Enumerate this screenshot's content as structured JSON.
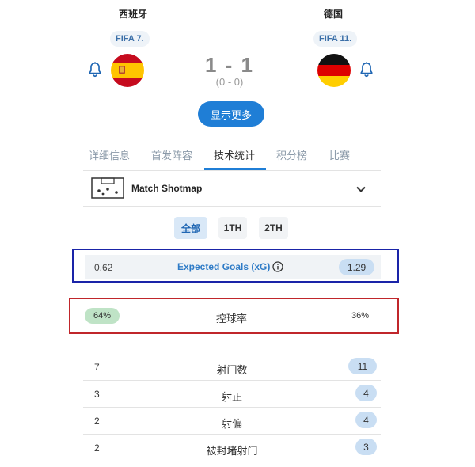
{
  "match": {
    "home": {
      "name": "西班牙",
      "fifa_rank": "FIFA 7.",
      "flag": "spain-flag"
    },
    "away": {
      "name": "德国",
      "fifa_rank": "FIFA 11.",
      "flag": "germany-flag"
    },
    "score": "1 - 1",
    "halftime": "(0 - 0)",
    "more_label": "显示更多"
  },
  "tabs": [
    {
      "label": "详细信息",
      "active": false
    },
    {
      "label": "首发阵容",
      "active": false
    },
    {
      "label": "技术统计",
      "active": true
    },
    {
      "label": "积分榜",
      "active": false
    },
    {
      "label": "比赛",
      "active": false
    }
  ],
  "shotmap": {
    "label": "Match Shotmap",
    "icon": "pitch-icon",
    "toggle_icon": "chevron-down-icon"
  },
  "periods": [
    {
      "label": "全部",
      "active": true
    },
    {
      "label": "1TH",
      "active": false
    },
    {
      "label": "2TH",
      "active": false
    }
  ],
  "stats": {
    "xg": {
      "label": "Expected Goals (xG)",
      "home": "0.62",
      "away": "1.29"
    },
    "possession": {
      "label": "控球率",
      "home": "64%",
      "away": "36%"
    },
    "rows": [
      {
        "label": "射门数",
        "home": "7",
        "away": "11"
      },
      {
        "label": "射正",
        "home": "3",
        "away": "4"
      },
      {
        "label": "射偏",
        "home": "2",
        "away": "4"
      },
      {
        "label": "被封堵射门",
        "home": "2",
        "away": "3"
      }
    ]
  },
  "colors": {
    "accent": "#1f7ed6",
    "highlight_blue_box": "#1a24a8",
    "highlight_red_box": "#c0262b",
    "home_leader_pill": "#bfe3c6",
    "away_leader_pill": "#c9def3"
  }
}
